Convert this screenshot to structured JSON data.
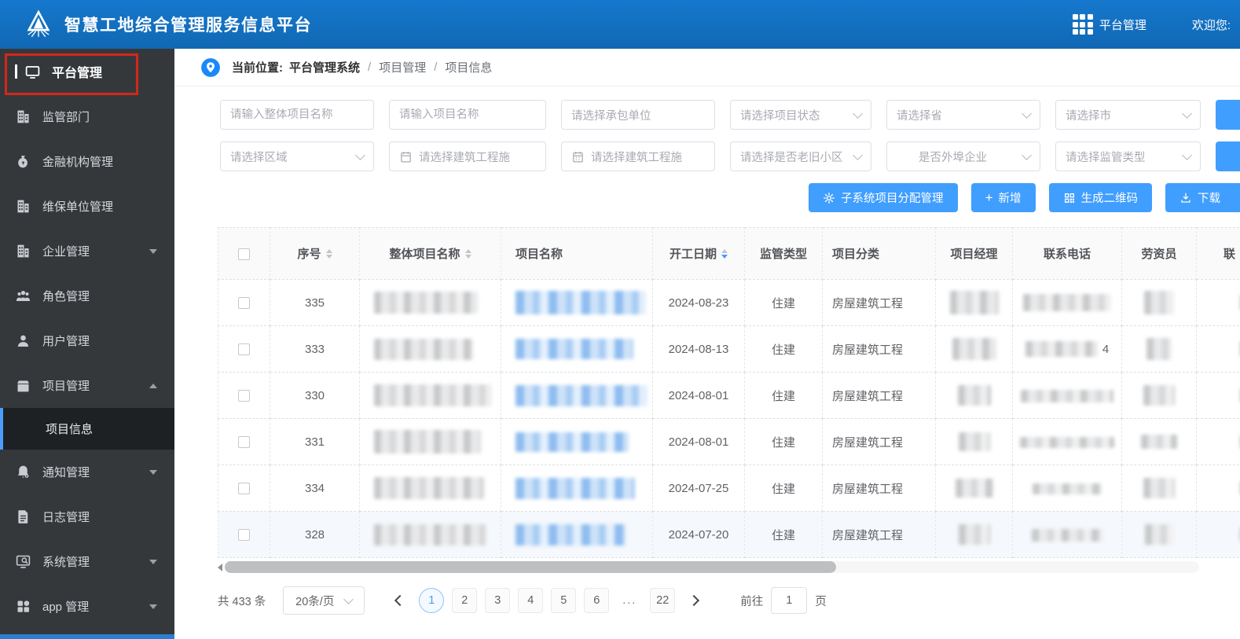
{
  "colors": {
    "header_blue": "#1373c4",
    "accent_blue": "#409eff",
    "sidebar_dark": "#35383b",
    "annotation_red": "#d3271c"
  },
  "header": {
    "title": "智慧工地综合管理服务信息平台",
    "nav_platform": "平台管理",
    "welcome": "欢迎您:"
  },
  "sidebar": {
    "items": [
      {
        "label": "平台管理"
      },
      {
        "label": "监管部门"
      },
      {
        "label": "金融机构管理"
      },
      {
        "label": "维保单位管理"
      },
      {
        "label": "企业管理"
      },
      {
        "label": "角色管理"
      },
      {
        "label": "用户管理"
      },
      {
        "label": "项目管理"
      },
      {
        "label": "项目信息"
      },
      {
        "label": "通知管理"
      },
      {
        "label": "日志管理"
      },
      {
        "label": "系统管理"
      },
      {
        "label": "app 管理"
      }
    ]
  },
  "breadcrumb": {
    "prefix": "当前位置:",
    "root": "平台管理系统",
    "sep": "/",
    "section": "项目管理",
    "page": "项目信息"
  },
  "filters": {
    "f1": "请输入整体项目名称",
    "f2": "请输入项目名称",
    "f3": "请选择承包单位",
    "f4": "请选择项目状态",
    "f5": "请选择省",
    "f6": "请选择市",
    "f7": "请选择区域",
    "f8": "请选择建筑工程施",
    "f9": "请选择建筑工程施",
    "f10": "请选择是否老旧小区",
    "f11": "是否外埠企业",
    "f12": "请选择监管类型"
  },
  "actions": {
    "assign": "子系统项目分配管理",
    "add_plus": "+",
    "add": "新增",
    "qrcode": "生成二维码",
    "download": "下载"
  },
  "table": {
    "col_seq": "序号",
    "col_overall": "整体项目名称",
    "col_name": "项目名称",
    "col_start": "开工日期",
    "col_supervision": "监管类型",
    "col_category": "项目分类",
    "col_manager": "项目经理",
    "col_phone": "联系电话",
    "col_labor": "劳资员",
    "col_last": "联",
    "rows": [
      {
        "seq": "335",
        "date": "2024-08-23",
        "sup": "住建",
        "cat": "房屋建筑工程"
      },
      {
        "seq": "333",
        "date": "2024-08-13",
        "sup": "住建",
        "cat": "房屋建筑工程",
        "phone_visible": "4"
      },
      {
        "seq": "330",
        "date": "2024-08-01",
        "sup": "住建",
        "cat": "房屋建筑工程"
      },
      {
        "seq": "331",
        "date": "2024-08-01",
        "sup": "住建",
        "cat": "房屋建筑工程"
      },
      {
        "seq": "334",
        "date": "2024-07-25",
        "sup": "住建",
        "cat": "房屋建筑工程"
      },
      {
        "seq": "328",
        "date": "2024-07-20",
        "sup": "住建",
        "cat": "房屋建筑工程"
      }
    ]
  },
  "pagination": {
    "total": "共 433 条",
    "page_size": "20条/页",
    "pages": [
      "1",
      "2",
      "3",
      "4",
      "5",
      "6",
      "...",
      "22"
    ],
    "goto": "前往",
    "goto_value": "1",
    "unit": "页"
  }
}
